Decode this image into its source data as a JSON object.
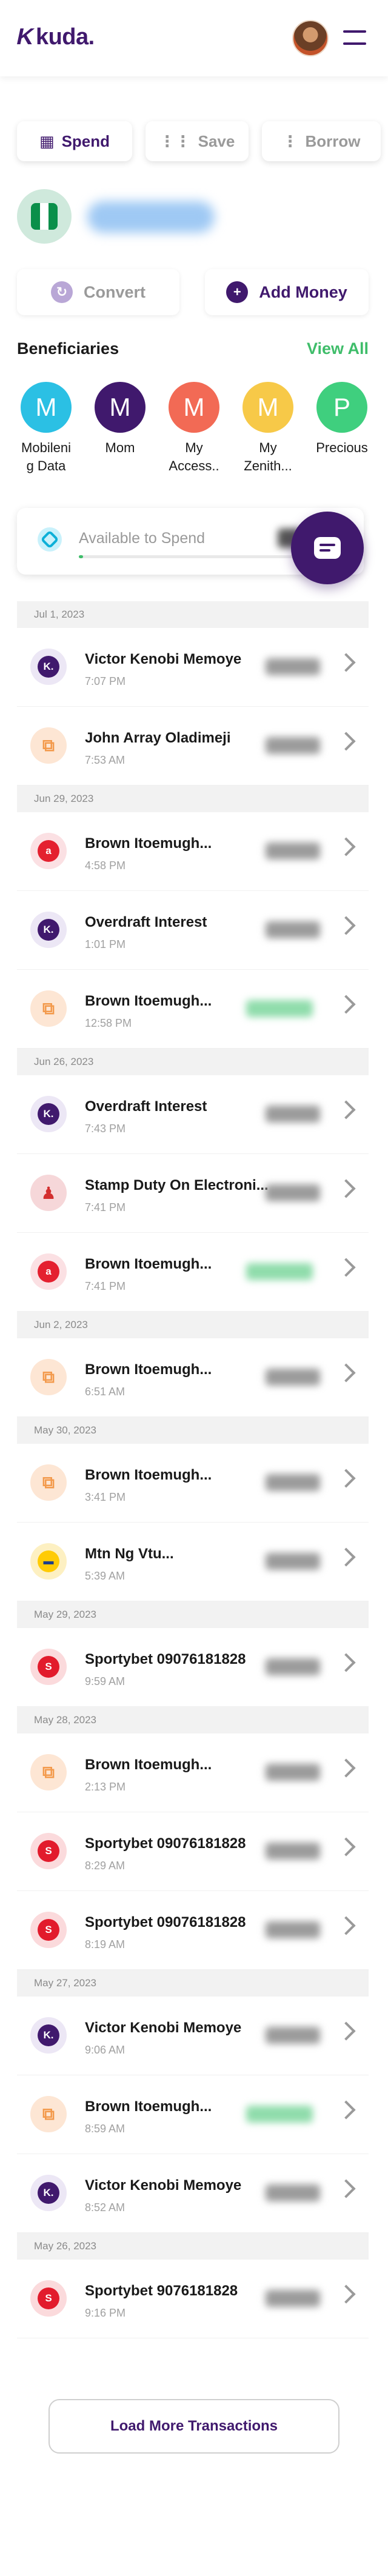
{
  "header": {
    "logo": "kuda.",
    "logo_mark": "K"
  },
  "tabs": [
    {
      "label": "Spend",
      "icon": "wallet-icon",
      "active": true
    },
    {
      "label": "Save",
      "icon": "grid-icon",
      "active": false
    },
    {
      "label": "Borrow",
      "icon": "dots-icon",
      "active": false
    }
  ],
  "profile": {
    "flag": "nigeria-flag-icon"
  },
  "actions": {
    "convert": {
      "label": "Convert",
      "icon": "convert-icon"
    },
    "add_money": {
      "label": "Add Money",
      "icon": "plus-icon"
    }
  },
  "beneficiaries": {
    "title": "Beneficiaries",
    "view_all": "View All",
    "items": [
      {
        "initial": "M",
        "label": "Mobileni g Data",
        "color": "#2bc0e4"
      },
      {
        "initial": "M",
        "label": "Mom",
        "color": "#40196d"
      },
      {
        "initial": "M",
        "label": "My Access..",
        "color": "#f26a55"
      },
      {
        "initial": "M",
        "label": "My Zenith...",
        "color": "#f7c948"
      },
      {
        "initial": "P",
        "label": "Precious",
        "color": "#3fcf7e"
      }
    ]
  },
  "available": {
    "label": "Available to Spend",
    "progress": 0.02
  },
  "transactions": [
    {
      "date": "Jul 1, 2023",
      "items": [
        {
          "name": "Victor Kenobi Memoye",
          "time": "7:07 PM",
          "icon": "kuda-icon",
          "credit": false
        },
        {
          "name": "John Array Oladimeji",
          "time": "7:53 AM",
          "icon": "transfer-icon",
          "credit": false
        }
      ]
    },
    {
      "date": "Jun 29, 2023",
      "items": [
        {
          "name": "Brown Itoemugh...",
          "time": "4:58 PM",
          "icon": "airtel-icon",
          "credit": false
        },
        {
          "name": "Overdraft Interest",
          "time": "1:01 PM",
          "icon": "kuda-icon",
          "credit": false
        },
        {
          "name": "Brown Itoemugh...",
          "time": "12:58 PM",
          "icon": "transfer-icon",
          "credit": true
        }
      ]
    },
    {
      "date": "Jun 26, 2023",
      "items": [
        {
          "name": "Overdraft Interest",
          "time": "7:43 PM",
          "icon": "kuda-icon",
          "credit": false
        },
        {
          "name": "Stamp Duty On Electroni...",
          "time": "7:41 PM",
          "icon": "stamp-icon",
          "credit": false
        },
        {
          "name": "Brown Itoemugh...",
          "time": "7:41 PM",
          "icon": "airtel-icon",
          "credit": true
        }
      ]
    },
    {
      "date": "Jun 2, 2023",
      "items": [
        {
          "name": "Brown Itoemugh...",
          "time": "6:51 AM",
          "icon": "transfer-icon",
          "credit": false
        }
      ]
    },
    {
      "date": "May 30, 2023",
      "items": [
        {
          "name": "Brown Itoemugh...",
          "time": "3:41 PM",
          "icon": "transfer-icon",
          "credit": false
        },
        {
          "name": "Mtn Ng Vtu...",
          "time": "5:39 AM",
          "icon": "mtn-icon",
          "credit": false
        }
      ]
    },
    {
      "date": "May 29, 2023",
      "items": [
        {
          "name": "Sportybet 09076181828",
          "time": "9:59 AM",
          "icon": "sportybet-icon",
          "credit": false
        }
      ]
    },
    {
      "date": "May 28, 2023",
      "items": [
        {
          "name": "Brown Itoemugh...",
          "time": "2:13 PM",
          "icon": "transfer-icon",
          "credit": false
        },
        {
          "name": "Sportybet 09076181828",
          "time": "8:29 AM",
          "icon": "sportybet-icon",
          "credit": false
        },
        {
          "name": "Sportybet 09076181828",
          "time": "8:19 AM",
          "icon": "sportybet-icon",
          "credit": false
        }
      ]
    },
    {
      "date": "May 27, 2023",
      "items": [
        {
          "name": "Victor Kenobi Memoye",
          "time": "9:06 AM",
          "icon": "kuda-icon",
          "credit": false
        },
        {
          "name": "Brown Itoemugh...",
          "time": "8:59 AM",
          "icon": "transfer-icon",
          "credit": true
        },
        {
          "name": "Victor Kenobi Memoye",
          "time": "8:52 AM",
          "icon": "kuda-icon",
          "credit": false
        }
      ]
    },
    {
      "date": "May 26, 2023",
      "items": [
        {
          "name": "Sportybet 9076181828",
          "time": "9:16 PM",
          "icon": "sportybet-icon",
          "credit": false
        }
      ]
    }
  ],
  "load_more": "Load More Transactions",
  "colors": {
    "brand": "#40196d",
    "accent_green": "#3fbd6a"
  }
}
